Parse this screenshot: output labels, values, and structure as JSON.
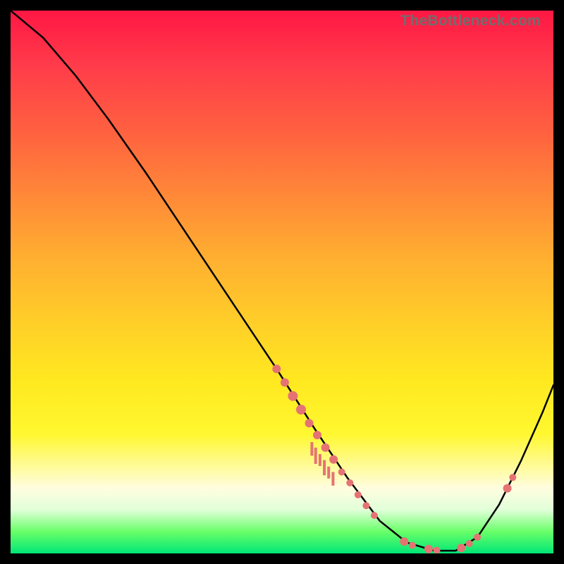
{
  "watermark": "TheBottleneck.com",
  "chart_data": {
    "type": "line",
    "title": "",
    "xlabel": "",
    "ylabel": "",
    "xlim": [
      0,
      100
    ],
    "ylim": [
      0,
      100
    ],
    "curve": [
      {
        "x": 0,
        "y": 100
      },
      {
        "x": 6,
        "y": 95
      },
      {
        "x": 12,
        "y": 88
      },
      {
        "x": 18,
        "y": 80
      },
      {
        "x": 25,
        "y": 70
      },
      {
        "x": 33,
        "y": 58
      },
      {
        "x": 41,
        "y": 46
      },
      {
        "x": 49,
        "y": 34
      },
      {
        "x": 56,
        "y": 23
      },
      {
        "x": 62,
        "y": 14
      },
      {
        "x": 68,
        "y": 6
      },
      {
        "x": 73,
        "y": 2
      },
      {
        "x": 78,
        "y": 0.5
      },
      {
        "x": 82,
        "y": 0.5
      },
      {
        "x": 86,
        "y": 3
      },
      {
        "x": 90,
        "y": 9
      },
      {
        "x": 94,
        "y": 17
      },
      {
        "x": 98,
        "y": 26
      },
      {
        "x": 100,
        "y": 31
      }
    ],
    "dot_clusters_left": [
      {
        "x": 49,
        "y": 34,
        "r": 6
      },
      {
        "x": 50.5,
        "y": 31.5,
        "r": 6
      },
      {
        "x": 52,
        "y": 29,
        "r": 7
      },
      {
        "x": 53.5,
        "y": 26.5,
        "r": 7
      },
      {
        "x": 55,
        "y": 24,
        "r": 6
      },
      {
        "x": 56.5,
        "y": 21.8,
        "r": 6
      },
      {
        "x": 58,
        "y": 19.5,
        "r": 6
      },
      {
        "x": 59.5,
        "y": 17.3,
        "r": 6
      },
      {
        "x": 61,
        "y": 15,
        "r": 5
      },
      {
        "x": 62.5,
        "y": 13,
        "r": 5
      },
      {
        "x": 64,
        "y": 10.8,
        "r": 5
      },
      {
        "x": 65.5,
        "y": 8.8,
        "r": 5
      },
      {
        "x": 67,
        "y": 7,
        "r": 5
      }
    ],
    "dot_clusters_bottom": [
      {
        "x": 72.5,
        "y": 2.2,
        "r": 6
      },
      {
        "x": 74,
        "y": 1.5,
        "r": 5
      },
      {
        "x": 77,
        "y": 0.8,
        "r": 6
      },
      {
        "x": 78.5,
        "y": 0.6,
        "r": 5
      },
      {
        "x": 83,
        "y": 1,
        "r": 6
      },
      {
        "x": 84.5,
        "y": 1.8,
        "r": 5
      },
      {
        "x": 86,
        "y": 3,
        "r": 5
      }
    ],
    "dot_clusters_right": [
      {
        "x": 91.5,
        "y": 12,
        "r": 6
      },
      {
        "x": 92.5,
        "y": 14,
        "r": 5
      }
    ],
    "mini_bars": [
      {
        "x": 55.5,
        "y": 20.5,
        "h": 2.5
      },
      {
        "x": 56.2,
        "y": 19.5,
        "h": 3
      },
      {
        "x": 57,
        "y": 18.3,
        "h": 2.2
      },
      {
        "x": 57.8,
        "y": 17.2,
        "h": 2.8
      },
      {
        "x": 58.6,
        "y": 16,
        "h": 2.2
      },
      {
        "x": 59.4,
        "y": 15,
        "h": 2.5
      }
    ]
  }
}
